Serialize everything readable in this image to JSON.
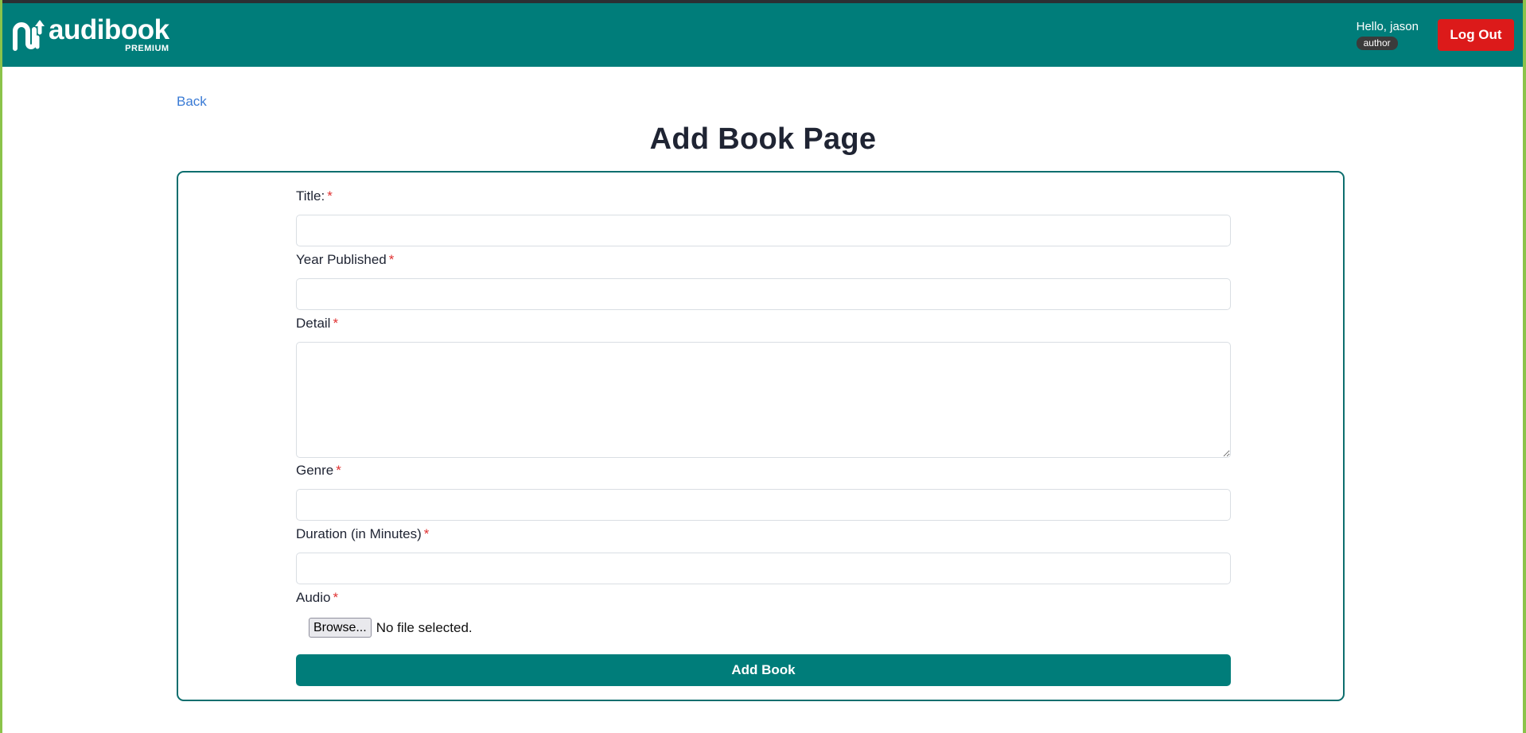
{
  "colors": {
    "navbar": "#007d7a",
    "logout": "#dc1a1a",
    "link": "#3a7bd5",
    "required": "#e03131",
    "card_border": "#0d6e6e",
    "frame": "#8bc34a"
  },
  "brand": {
    "name": "audibook",
    "tier": "PREMIUM",
    "icon": "audibook-logo-icon"
  },
  "user": {
    "greeting": "Hello, jason",
    "role": "author",
    "logout_label": "Log Out"
  },
  "nav": {
    "back_label": "Back"
  },
  "page": {
    "title": "Add Book Page"
  },
  "form": {
    "required_marker": "*",
    "fields": {
      "title": {
        "label": "Title:",
        "value": ""
      },
      "year": {
        "label": "Year Published",
        "value": ""
      },
      "detail": {
        "label": "Detail",
        "value": ""
      },
      "genre": {
        "label": "Genre",
        "value": ""
      },
      "duration": {
        "label": "Duration (in Minutes)",
        "value": ""
      },
      "audio": {
        "label": "Audio",
        "browse_label": "Browse...",
        "status": "No file selected."
      }
    },
    "submit_label": "Add Book"
  }
}
